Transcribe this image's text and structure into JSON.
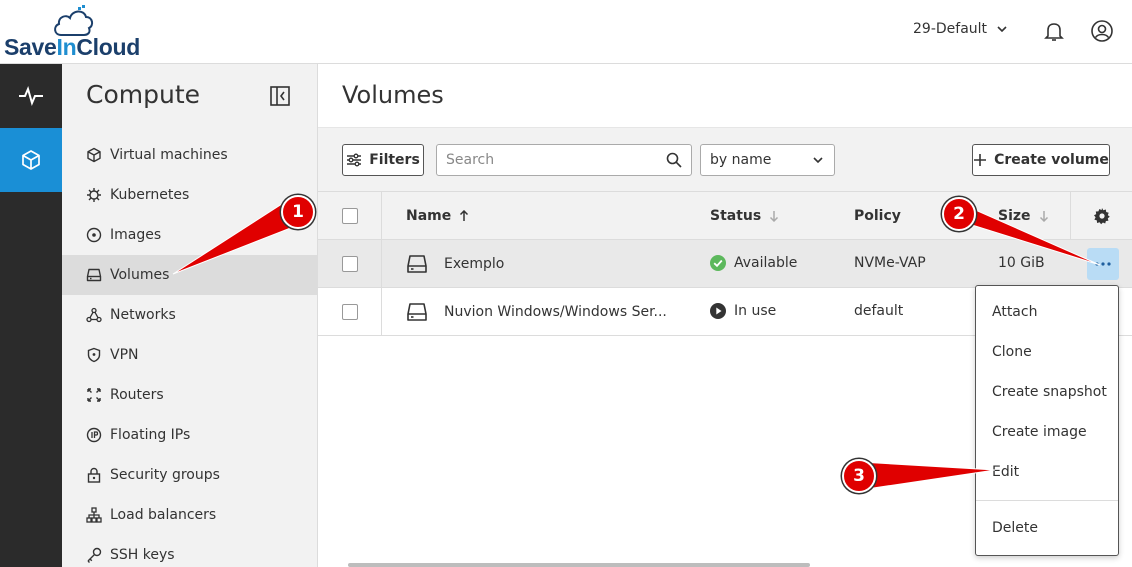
{
  "header": {
    "logo_prefix": "Save",
    "logo_in": "In",
    "logo_suffix": "Cloud",
    "environment": "29-Default",
    "notification_icon": "bell-icon",
    "user_icon": "user-circle-icon"
  },
  "rail": {
    "items": [
      {
        "icon": "activity-icon",
        "active": false
      },
      {
        "icon": "cube-icon",
        "active": true
      }
    ]
  },
  "sidebar": {
    "title": "Compute",
    "items": [
      {
        "label": "Virtual machines",
        "icon": "cube-icon"
      },
      {
        "label": "Kubernetes",
        "icon": "kubernetes-icon"
      },
      {
        "label": "Images",
        "icon": "disc-icon"
      },
      {
        "label": "Volumes",
        "icon": "drive-icon",
        "active": true
      },
      {
        "label": "Networks",
        "icon": "network-icon"
      },
      {
        "label": "VPN",
        "icon": "shield-icon"
      },
      {
        "label": "Routers",
        "icon": "router-icon"
      },
      {
        "label": "Floating IPs",
        "icon": "ip-icon"
      },
      {
        "label": "Security groups",
        "icon": "lock-icon"
      },
      {
        "label": "Load balancers",
        "icon": "load-balancer-icon"
      },
      {
        "label": "SSH keys",
        "icon": "key-icon"
      }
    ]
  },
  "main": {
    "title": "Volumes",
    "filters_label": "Filters",
    "search_placeholder": "Search",
    "sort_value": "by name",
    "create_label": "Create volume",
    "columns": {
      "name": "Name",
      "status": "Status",
      "policy": "Policy",
      "size": "Size"
    },
    "rows": [
      {
        "name": "Exemplo",
        "status": "Available",
        "policy": "NVMe-VAP",
        "size": "10 GiB"
      },
      {
        "name": "Nuvion Windows/Windows Ser...",
        "status": "In use",
        "policy": "default",
        "size": ""
      }
    ]
  },
  "menu": {
    "items": [
      "Attach",
      "Clone",
      "Create snapshot",
      "Create image",
      "Edit"
    ],
    "delete": "Delete"
  },
  "annotations": {
    "badges": [
      "1",
      "2",
      "3"
    ],
    "color": "#e00000"
  },
  "colors": {
    "accent": "#1a8fd6",
    "rail_bg": "#2b2b2b",
    "available": "#5cb85c",
    "in_use": "#333333"
  }
}
